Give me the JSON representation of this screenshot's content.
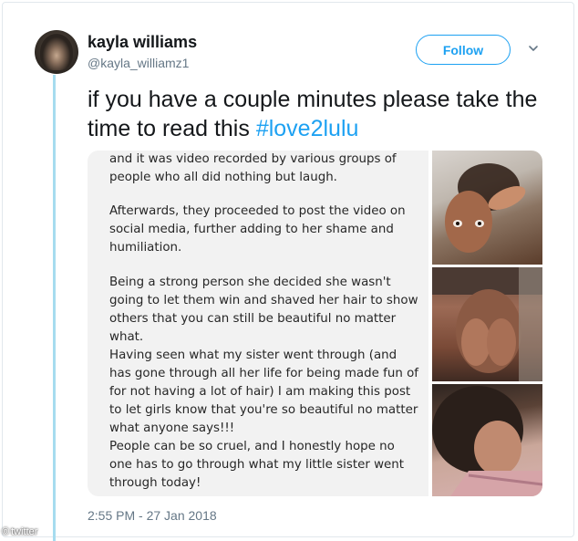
{
  "tweet": {
    "display_name": "kayla williams",
    "handle": "@kayla_williamz1",
    "follow_label": "Follow",
    "text_plain": "if you have a couple minutes please take the time to read this ",
    "hashtag": "#love2lulu",
    "timestamp": "2:55 PM - 27 Jan 2018"
  },
  "media": {
    "text_blocks": [
      {
        "lines": [
          "and it was video recorded by various groups of",
          "people who all did nothing but laugh."
        ]
      },
      {
        "lines": [
          "Afterwards, they proceeded to post the video on",
          "social media, further adding to her shame and",
          "humiliation."
        ]
      },
      {
        "lines": [
          "Being a strong person she decided she wasn't",
          "going to let them win and shaved her hair to show",
          "others that you can still be beautiful no matter",
          "what.",
          "Having seen what my sister went through (and",
          "has gone through all her life for being made fun of",
          "for not having a lot of hair) I am making this post",
          "to let girls know that you're so beautiful no matter",
          "what anyone says!!!",
          "People can be so cruel, and I honestly hope no",
          "one has to go through what my little sister went",
          "through today!"
        ]
      }
    ]
  },
  "watermark": {
    "text": "twitter",
    "symbol": "©"
  },
  "colors": {
    "accent": "#1da1f2",
    "thread_line": "#a6dcef",
    "secondary_text": "#657786"
  },
  "icons": [
    "caret-down-icon"
  ]
}
